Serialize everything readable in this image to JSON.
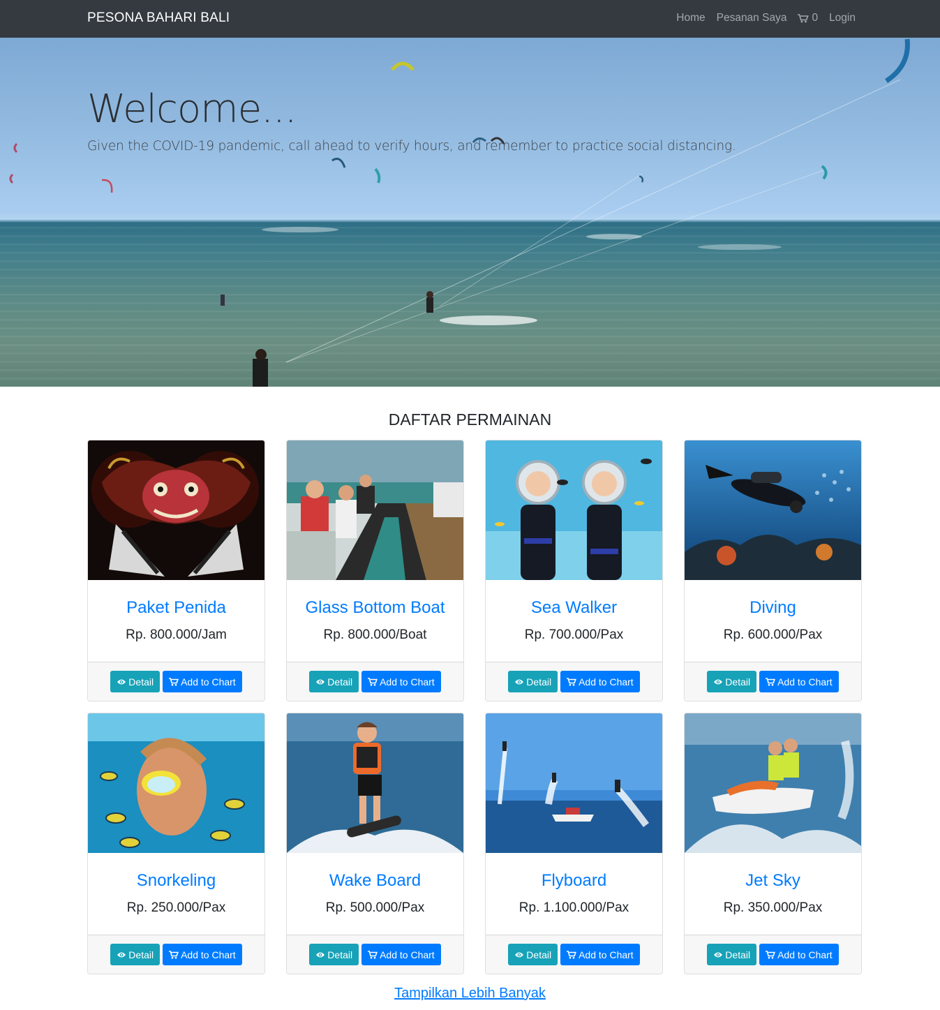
{
  "navbar": {
    "brand": "PESONA BAHARI BALI",
    "links": {
      "home": "Home",
      "orders": "Pesanan Saya",
      "cart_count": "0",
      "login": "Login"
    }
  },
  "hero": {
    "title": "Welcome...",
    "subtitle": "Given the COVID-19 pandemic, call ahead to verify hours, and remember to practice social distancing."
  },
  "section": {
    "title": "DAFTAR PERMAINAN"
  },
  "cards": [
    {
      "title": "Paket Penida",
      "price": "Rp. 800.000/Jam",
      "image": "barong-mask"
    },
    {
      "title": "Glass Bottom Boat",
      "price": "Rp. 800.000/Boat",
      "image": "glass-bottom-boat"
    },
    {
      "title": "Sea Walker",
      "price": "Rp. 700.000/Pax",
      "image": "sea-walker"
    },
    {
      "title": "Diving",
      "price": "Rp. 600.000/Pax",
      "image": "diver"
    },
    {
      "title": "Snorkeling",
      "price": "Rp. 250.000/Pax",
      "image": "snorkeler"
    },
    {
      "title": "Wake Board",
      "price": "Rp. 500.000/Pax",
      "image": "wakeboarder"
    },
    {
      "title": "Flyboard",
      "price": "Rp. 1.100.000/Pax",
      "image": "flyboard"
    },
    {
      "title": "Jet Sky",
      "price": "Rp. 350.000/Pax",
      "image": "jet-ski"
    }
  ],
  "buttons": {
    "detail": "Detail",
    "add_to_cart": "Add to Chart"
  },
  "footer": {
    "more": "Tampilkan Lebih Banyak"
  },
  "colors": {
    "navbar": "#343a40",
    "primary": "#007bff",
    "info": "#17a2b8"
  }
}
